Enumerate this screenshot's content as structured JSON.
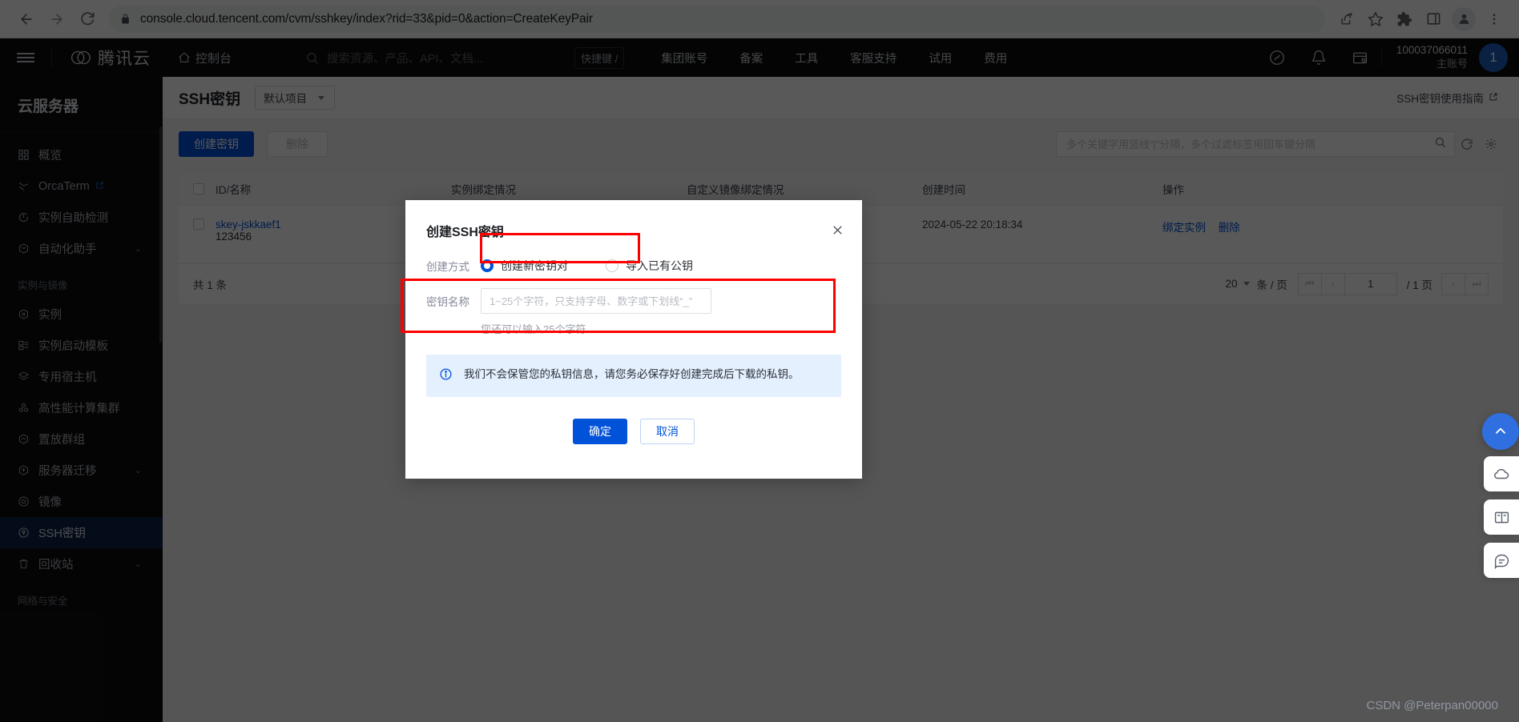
{
  "browser": {
    "url": "console.cloud.tencent.com/cvm/sshkey/index?rid=33&pid=0&action=CreateKeyPair",
    "back_label": "Back",
    "forward_label": "Forward",
    "reload_label": "Reload",
    "share_label": "Share",
    "bookmark_label": "Bookmark",
    "extensions_label": "Extensions",
    "sidepanel_label": "Side panel",
    "profile_label": "Profile",
    "menu_label": "Customize and control"
  },
  "topnav": {
    "brand": "腾讯云",
    "console": "控制台",
    "search_placeholder": "搜索资源、产品、API、文档...",
    "shortcut": "快捷键 /",
    "menu": [
      "集团账号",
      "备案",
      "工具",
      "客服支持",
      "试用",
      "费用"
    ],
    "account_number": "100037066011",
    "account_role": "主账号",
    "avatar_text": "1"
  },
  "sidebar": {
    "title": "云服务器",
    "items": [
      {
        "label": "概览",
        "icon": "grid-icon",
        "chevron": false,
        "external": false,
        "active": false
      },
      {
        "label": "OrcaTerm",
        "icon": "terminal-icon",
        "chevron": false,
        "external": true,
        "active": false
      },
      {
        "label": "实例自助检测",
        "icon": "diagnose-icon",
        "chevron": false,
        "external": false,
        "active": false
      },
      {
        "label": "自动化助手",
        "icon": "robot-icon",
        "chevron": true,
        "external": false,
        "active": false
      }
    ],
    "group_1": "实例与镜像",
    "items_2": [
      {
        "label": "实例",
        "icon": "instance-icon",
        "chevron": false,
        "active": false
      },
      {
        "label": "实例启动模板",
        "icon": "template-icon",
        "chevron": false,
        "active": false
      },
      {
        "label": "专用宿主机",
        "icon": "host-icon",
        "chevron": false,
        "active": false
      },
      {
        "label": "高性能计算集群",
        "icon": "cluster-icon",
        "chevron": false,
        "active": false
      },
      {
        "label": "置放群组",
        "icon": "placement-icon",
        "chevron": false,
        "active": false
      },
      {
        "label": "服务器迁移",
        "icon": "migrate-icon",
        "chevron": true,
        "active": false
      },
      {
        "label": "镜像",
        "icon": "image-icon",
        "chevron": false,
        "active": false
      },
      {
        "label": "SSH密钥",
        "icon": "key-icon",
        "chevron": false,
        "active": true
      },
      {
        "label": "回收站",
        "icon": "trash-icon",
        "chevron": true,
        "active": false
      }
    ],
    "group_2": "网络与安全"
  },
  "page": {
    "title": "SSH密钥",
    "project_select": "默认项目",
    "guide_link": "SSH密钥使用指南"
  },
  "toolbar": {
    "create_label": "创建密钥",
    "delete_label": "删除",
    "search_placeholder": "多个关键字用竖线“|”分隔，多个过滤标签用回车键分隔",
    "search_value": ""
  },
  "table": {
    "columns": [
      "ID/名称",
      "实例绑定情况",
      "自定义镜像绑定情况",
      "创建时间",
      "操作"
    ],
    "rows": [
      {
        "id": "skey-jskkaef1",
        "name": "123456",
        "instance_binding": "",
        "image_binding": "",
        "created_at": "2024-05-22 20:18:34",
        "actions": [
          "绑定实例",
          "删除"
        ]
      }
    ],
    "footer_total": "共 1 条",
    "page_size": "20",
    "page_size_unit": "条 / 页",
    "current_page": "1",
    "total_pages": "/ 1 页"
  },
  "modal": {
    "title": "创建SSH密钥",
    "close_label": "×",
    "method_label": "创建方式",
    "method_options": [
      {
        "label": "创建新密钥对",
        "selected": true
      },
      {
        "label": "导入已有公钥",
        "selected": false
      }
    ],
    "name_label": "密钥名称",
    "name_placeholder": "1~25个字符，只支持字母、数字或下划线“_”",
    "name_value": "",
    "helper_text": "您还可以输入25个字符",
    "alert_text": "我们不会保管您的私钥信息，请您务必保存好创建完成后下载的私钥。",
    "confirm_label": "确定",
    "cancel_label": "取消"
  },
  "rail": {
    "items": [
      "cloud-icon",
      "docs-icon",
      "chat-icon"
    ],
    "top_icon": "scroll-top-icon"
  },
  "watermark": "CSDN @Peterpan00000",
  "colors": {
    "accent": "#0052d9",
    "highlight": "#ff0000",
    "dark_bg": "#0d0d0d",
    "active_nav": "#0b2446"
  }
}
